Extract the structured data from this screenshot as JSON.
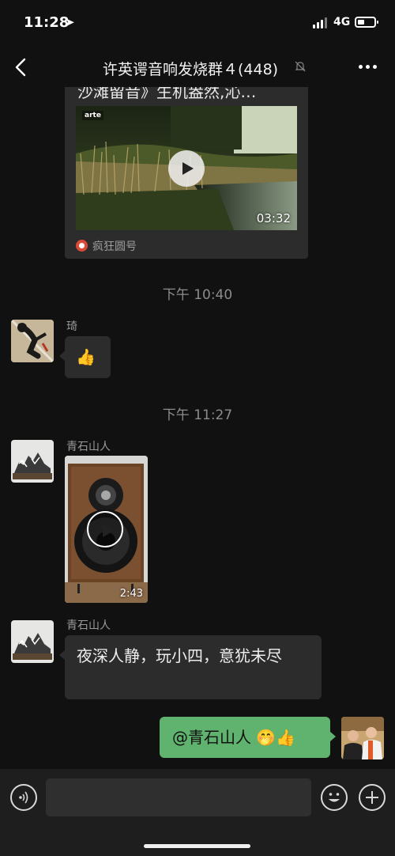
{
  "status_bar": {
    "time": "11:28",
    "network": "4G"
  },
  "header": {
    "title": "许英谔音响发烧群４(448)"
  },
  "messages": {
    "channel_card": {
      "title": "沙滩留音》生机盎然,沁…",
      "duration": "03:32",
      "source": "疯狂圆号",
      "logo": "arte"
    },
    "time1": "下午 10:40",
    "msg1": {
      "sender": "琦",
      "content": "👍"
    },
    "time2": "下午 11:27",
    "msg2": {
      "sender": "青石山人",
      "duration": "2:43"
    },
    "msg3": {
      "sender": "青石山人",
      "text": "夜深人静，玩小四，意犹未尽"
    },
    "msg4": {
      "text": "@青石山人 🤭👍"
    }
  },
  "colors": {
    "background": "#111111",
    "bubble": "#2c2c2c",
    "my_bubble": "#5fb36e"
  }
}
